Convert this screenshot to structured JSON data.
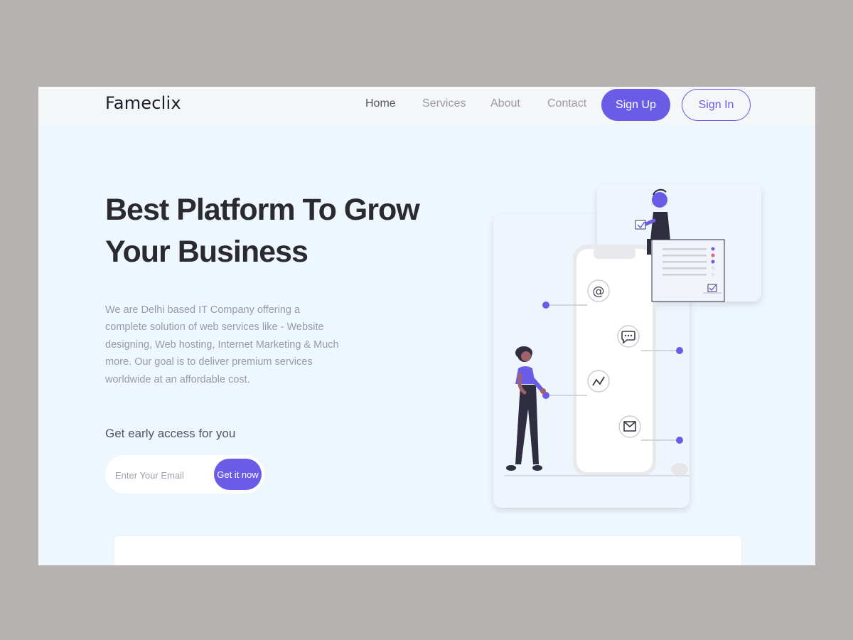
{
  "brand": {
    "name": "Fameclix"
  },
  "nav": {
    "items": [
      {
        "label": "Home"
      },
      {
        "label": "Services"
      },
      {
        "label": "About"
      },
      {
        "label": "Contact"
      }
    ],
    "signup_label": "Sign Up",
    "signin_label": "Sign In"
  },
  "hero": {
    "title_line1": "Best Platform To Grow",
    "title_line2": "Your Business",
    "description": "We are Delhi based IT Company offering a complete solution of web services like - Website designing, Web hosting, Internet Marketing & Much more. Our goal is to deliver premium services worldwide at an affordable cost."
  },
  "signup_form": {
    "heading": "Get early access for you",
    "email_placeholder": "Enter Your Email",
    "email_value": "",
    "submit_label": "Get it now"
  },
  "illustration": {
    "icons": [
      "at-sign-icon",
      "chat-bubble-icon",
      "trend-line-icon",
      "mail-icon"
    ]
  },
  "colors": {
    "accent": "#6b5ce7",
    "hero_bg": "#eef6fe",
    "nav_bg": "#f5f6f8",
    "page_bg": "#b6b2b2",
    "title": "#2a2a30"
  }
}
